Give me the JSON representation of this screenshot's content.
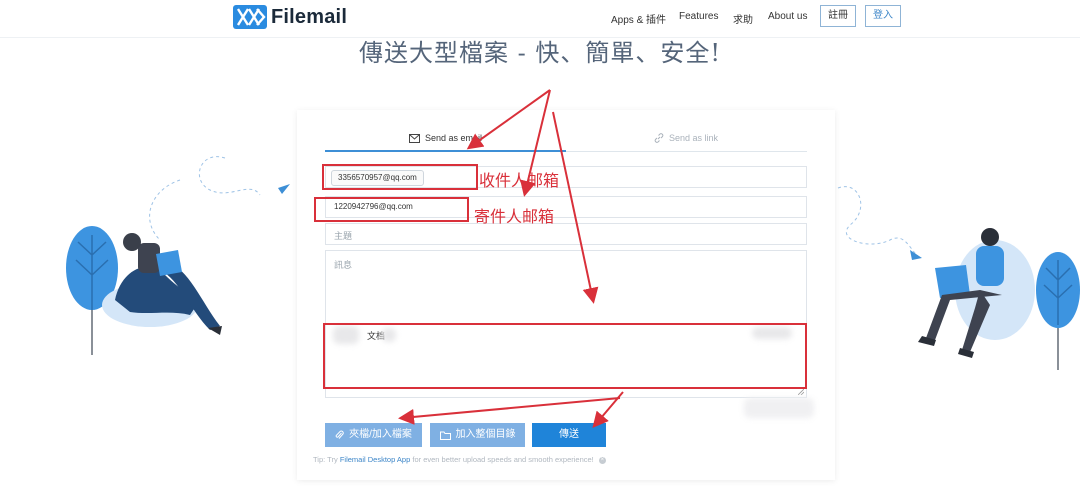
{
  "nav": {
    "logo_text": "Filemail",
    "links": [
      "Apps & 插件",
      "Features",
      "求助",
      "About us"
    ],
    "signup_label": "註冊",
    "signin_label": "登入"
  },
  "headline": "傳送大型檔案 - 快、簡單、安全!",
  "tabs": {
    "email_label": "Send as email",
    "link_label": "Send as link"
  },
  "form": {
    "recipient_value": "3356570957@qq.com",
    "sender_value": "1220942796@qq.com",
    "subject_placeholder": "主題",
    "message_placeholder": "訊息",
    "file_name": "文档",
    "add_files_label": "夾檔/加入檔案",
    "add_folder_label": "加入整個目錄",
    "send_label": "傳送",
    "tip_prefix": "Tip: Try",
    "tip_link": "Filemail Desktop App",
    "tip_suffix": "for even better upload speeds and smooth experience!"
  },
  "annotations": {
    "recipient_label": "收件人邮箱",
    "sender_label": "寄件人邮箱"
  },
  "colors": {
    "accent": "#1f84d9",
    "annotation_red": "#d9303a"
  }
}
